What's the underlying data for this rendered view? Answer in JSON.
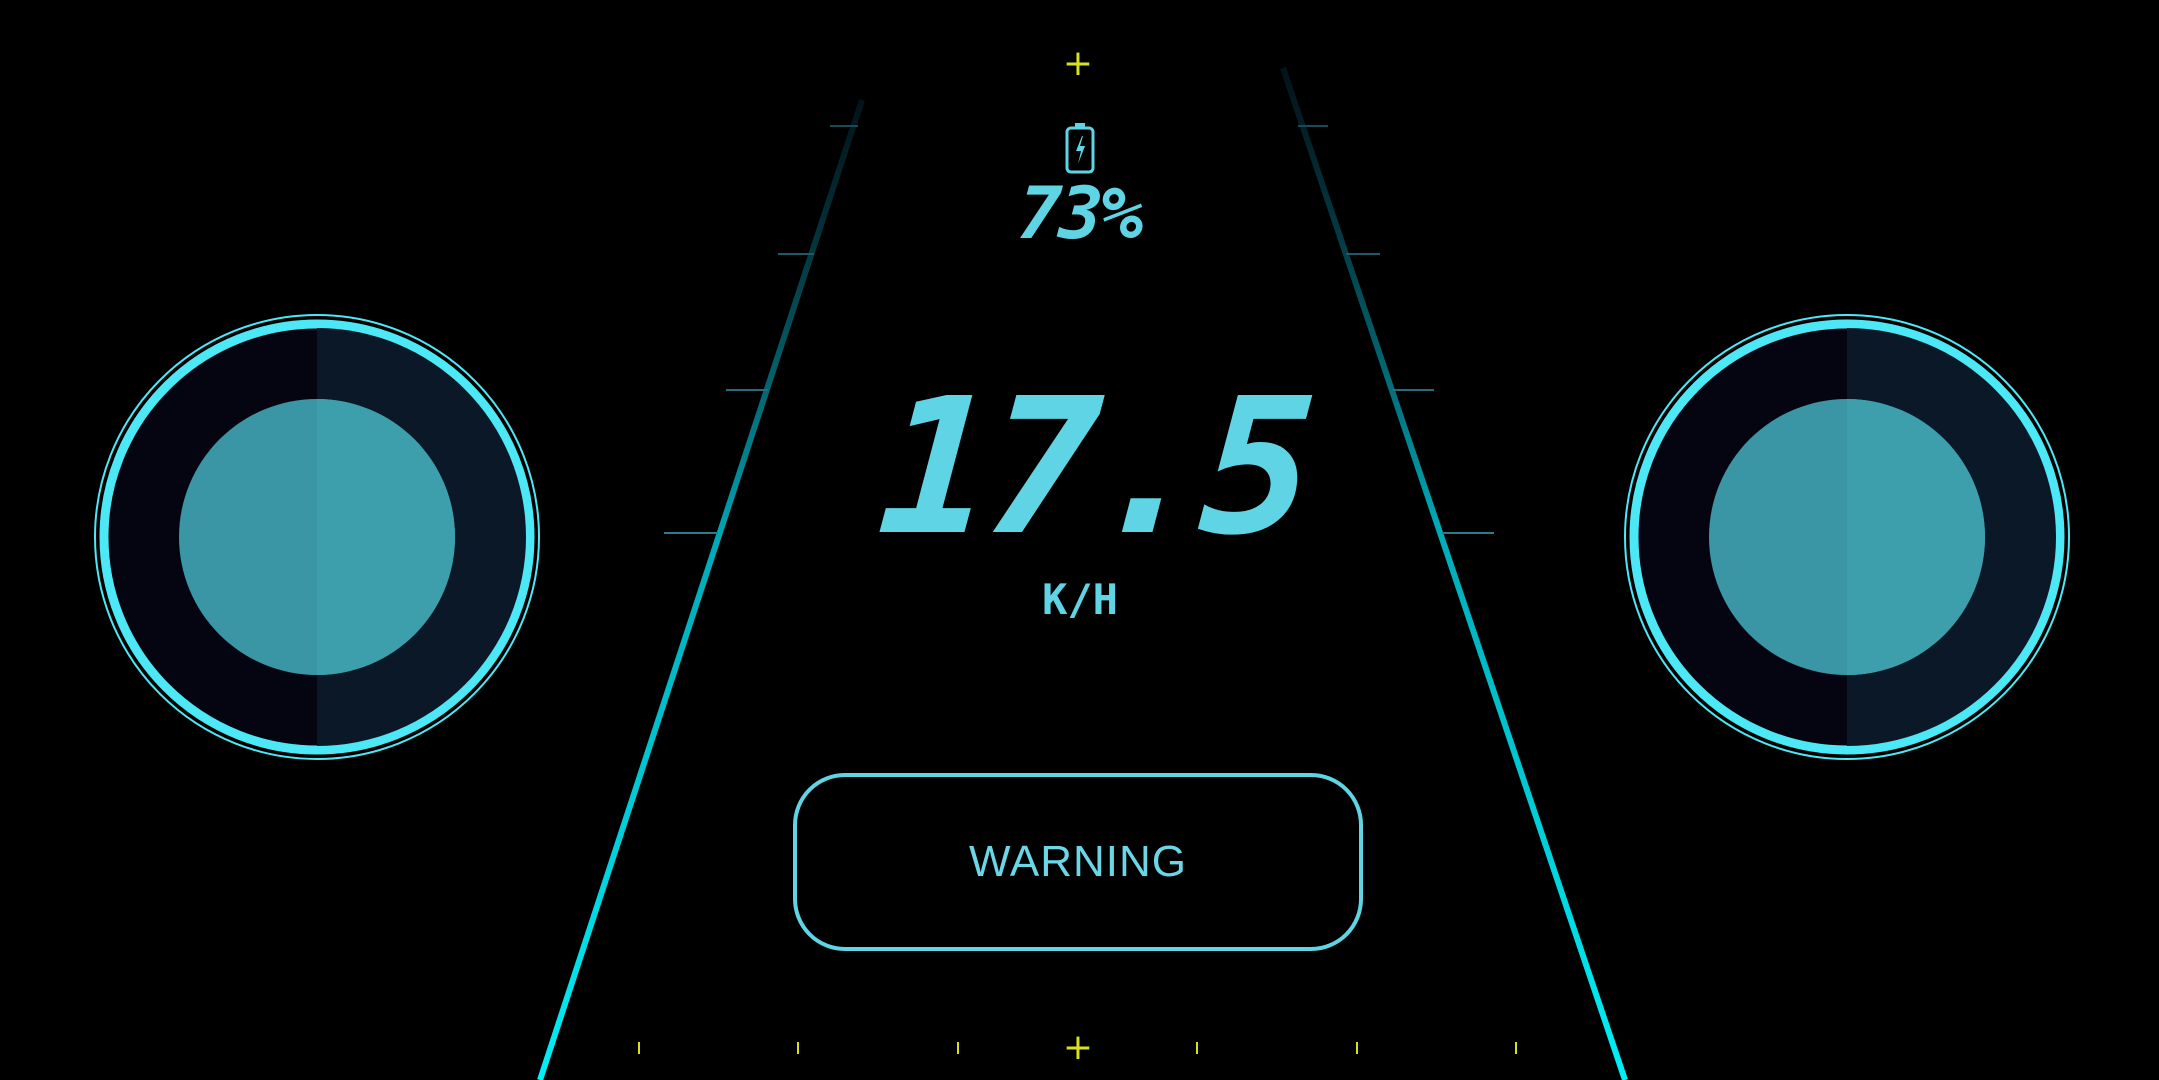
{
  "battery": {
    "icon": "battery-charging-icon",
    "percent": "73%"
  },
  "speed": {
    "value": "17.5",
    "unit": "K/H"
  },
  "warning": {
    "label": "WARNING"
  },
  "crosshair": {
    "symbol": "+"
  },
  "joysticks": {
    "left": {
      "name": "left-joystick"
    },
    "right": {
      "name": "right-joystick"
    }
  },
  "colors": {
    "background": "#000000",
    "accent": "#5fd4e4",
    "road_line": "#00e5f0",
    "crosshair": "#d8e020",
    "joystick_ring": "#4de8f5",
    "joystick_knob": "#3a9aa8"
  }
}
